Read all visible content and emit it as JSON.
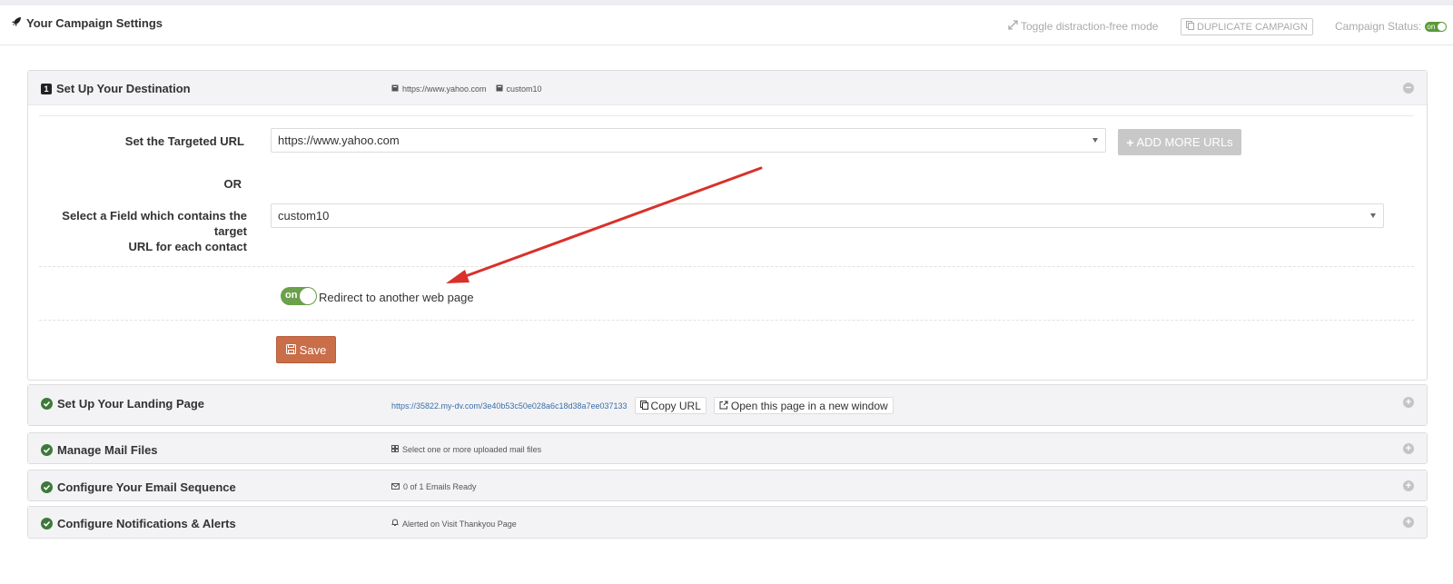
{
  "header": {
    "title": "Your Campaign Settings",
    "toggle_distraction": "Toggle distraction-free mode",
    "duplicate_label": "DUPLICATE CAMPAIGN",
    "status_label": "Campaign Status:",
    "status_toggle": "on"
  },
  "destination": {
    "step_number": "1",
    "title": "Set Up Your Destination",
    "info_url": "https://www.yahoo.com",
    "info_field": "custom10",
    "targeted_url_label": "Set the Targeted URL",
    "targeted_url_value": "https://www.yahoo.com",
    "add_more_urls": "ADD MORE URLs",
    "or_label": "OR",
    "field_label_line1": "Select a Field which contains the target",
    "field_label_line2": "URL for each contact",
    "field_value": "custom10",
    "redirect_toggle": "on",
    "redirect_label": "Redirect to another web page",
    "save_label": "Save"
  },
  "landing": {
    "title": "Set Up Your Landing Page",
    "url": "https://35822.my-dv.com/3e40b53c50e028a6c18d38a7ee037133",
    "copy_url": "Copy URL",
    "open_new": "Open this page in a new window"
  },
  "mail_files": {
    "title": "Manage Mail Files",
    "info": "Select one or more uploaded mail files"
  },
  "email_sequence": {
    "title": "Configure Your Email Sequence",
    "info": "0 of 1 Emails Ready"
  },
  "notifications": {
    "title": "Configure Notifications & Alerts",
    "info": "Alerted on Visit Thankyou Page"
  },
  "colors": {
    "save": "#c96e48",
    "toggle_on": "#6aa14a",
    "check": "#3d7a3a",
    "annotation_arrow": "#d9302a"
  }
}
